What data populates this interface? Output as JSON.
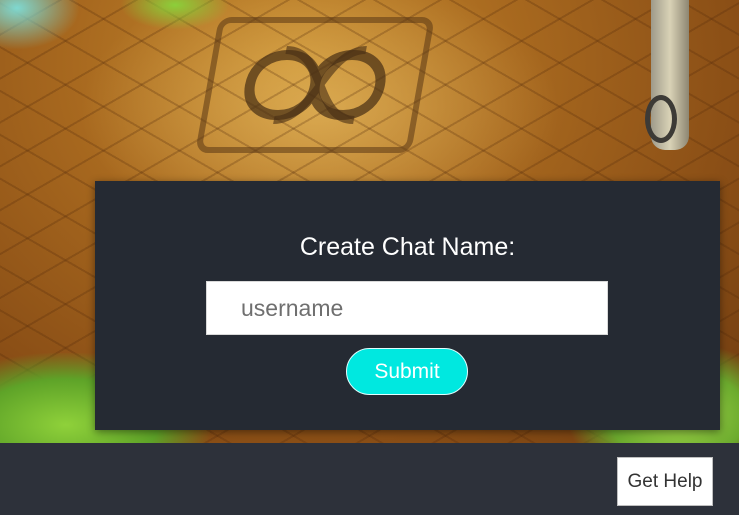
{
  "dialog": {
    "title": "Create Chat Name:",
    "input_placeholder": "username",
    "input_value": "",
    "submit_label": "Submit"
  },
  "footer": {
    "help_label": "Get Help"
  },
  "colors": {
    "dialog_bg": "#252a33",
    "footer_bg": "#2d313a",
    "submit_bg": "#00e8e0"
  }
}
